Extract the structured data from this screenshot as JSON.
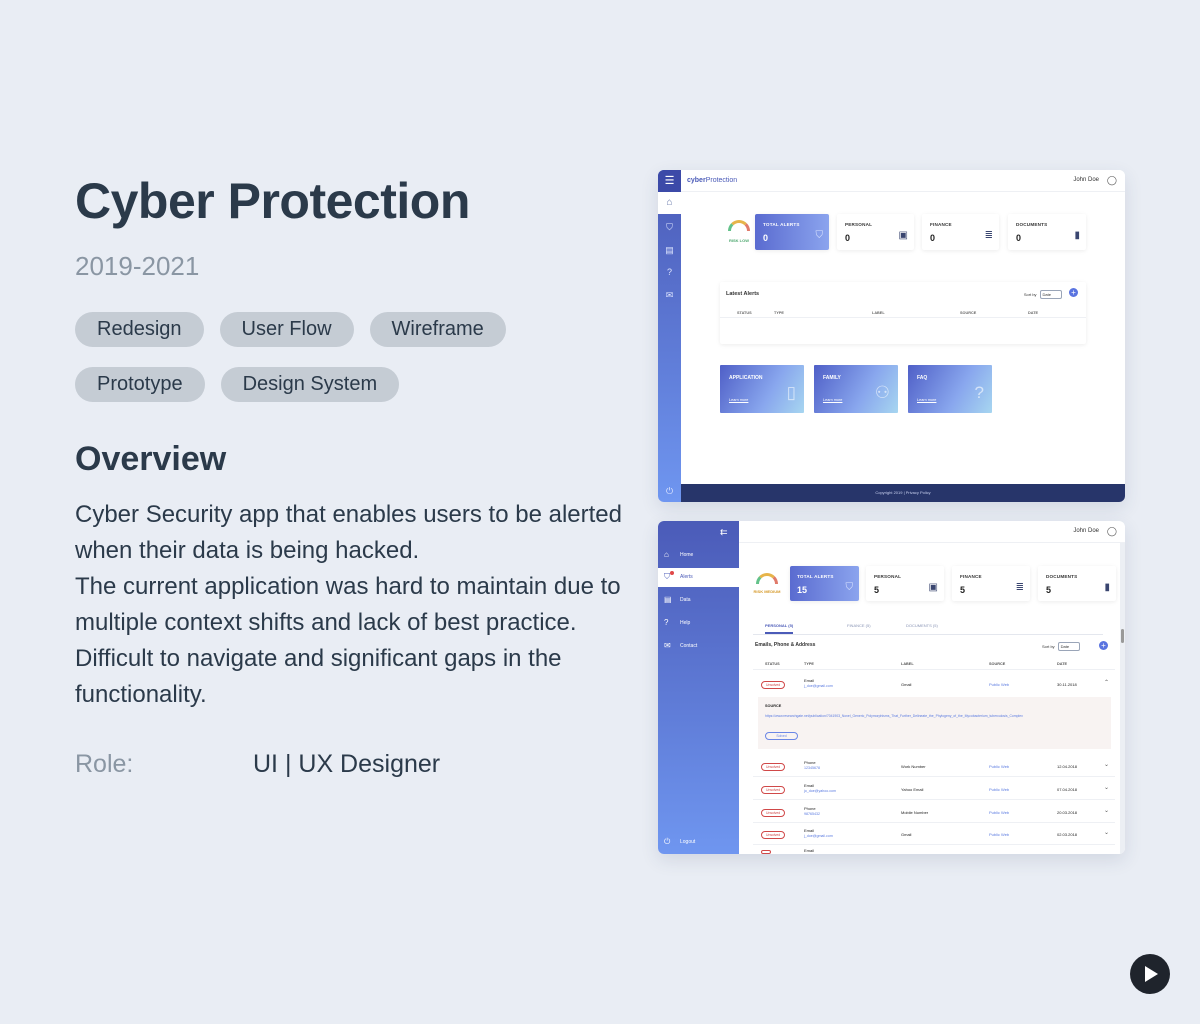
{
  "project": {
    "title": "Cyber Protection",
    "years": "2019-2021",
    "tags": [
      "Redesign",
      "User Flow",
      "Wireframe",
      "Prototype",
      "Design System"
    ],
    "overview_heading": "Overview",
    "description": [
      "Cyber Security app that enables users to be alerted when their data is being hacked.",
      "The current application was hard to maintain due to multiple context shifts and lack of best practice. Difficult to navigate and significant gaps in the functionality."
    ],
    "role_label": "Role:",
    "role_value": "UI | UX Designer"
  },
  "mock1": {
    "brand_prefix": "cyber",
    "brand_suffix": "Protection",
    "user": "John Doe",
    "risk_label": "RISK LOW",
    "cards": [
      {
        "title": "TOTAL ALERTS",
        "value": "0"
      },
      {
        "title": "PERSONAL",
        "value": "0"
      },
      {
        "title": "FINANCE",
        "value": "0"
      },
      {
        "title": "DOCUMENTS",
        "value": "0"
      }
    ],
    "latest_title": "Latest Alerts",
    "sort_label": "Sort by",
    "sort_value": "Date",
    "columns": [
      "STATUS",
      "TYPE",
      "LABEL",
      "SOURCE",
      "DATE"
    ],
    "features": [
      {
        "title": "APPLICATION",
        "link": "Learn more"
      },
      {
        "title": "FAMILY",
        "link": "Learn more"
      },
      {
        "title": "FAQ",
        "link": "Learn more"
      }
    ],
    "footer": "Copyright 2019  |  Privacy Policy"
  },
  "mock2": {
    "user": "John Doe",
    "nav": [
      "Home",
      "Alerts",
      "Data",
      "Help",
      "Contact"
    ],
    "logout": "Logout",
    "risk_label": "RISK MEDIUM",
    "cards": [
      {
        "title": "TOTAL ALERTS",
        "value": "15"
      },
      {
        "title": "PERSONAL",
        "value": "5"
      },
      {
        "title": "FINANCE",
        "value": "5"
      },
      {
        "title": "DOCUMENTS",
        "value": "5"
      }
    ],
    "tabs": [
      "PERSONAL (5)",
      "FINANCE (5)",
      "DOCUMENTS (5)"
    ],
    "section_title": "Emails, Phone & Address",
    "sort_label": "Sort by",
    "sort_value": "Date",
    "columns": [
      "STATUS",
      "TYPE",
      "LABEL",
      "SOURCE",
      "DATE"
    ],
    "first_row": {
      "status": "Unsolved",
      "type": "Email",
      "sub": "j_doe@gmail.com",
      "label": "Gmail",
      "source": "Public Web",
      "date": "30.11.2018"
    },
    "expanded": {
      "label": "SOURCE",
      "url": "https://www.researchgate.net/publication/7041903_Novel_Generic_Polymorphisms_That_Further_Delineate_the_Phylogeny_of_the_Mycobacterium_tuberculosis_Complex",
      "button": "Solved"
    },
    "rows": [
      {
        "status": "Unsolved",
        "type": "Phone",
        "sub": "12345678",
        "label": "Work Number",
        "source": "Public Web",
        "date": "12.04.2018"
      },
      {
        "status": "Unsolved",
        "type": "Email",
        "sub": "jo_doe@yahoo.com",
        "label": "Yahoo Email",
        "source": "Public Web",
        "date": "07.04.2018"
      },
      {
        "status": "Unsolved",
        "type": "Phone",
        "sub": "98765432",
        "label": "Mobile Number",
        "source": "Public Web",
        "date": "20.03.2018"
      },
      {
        "status": "Unsolved",
        "type": "Email",
        "sub": "j_doe@gmail.com",
        "label": "Gmail",
        "source": "Public Web",
        "date": "02.03.2018"
      }
    ],
    "partial_row_type": "Email"
  }
}
